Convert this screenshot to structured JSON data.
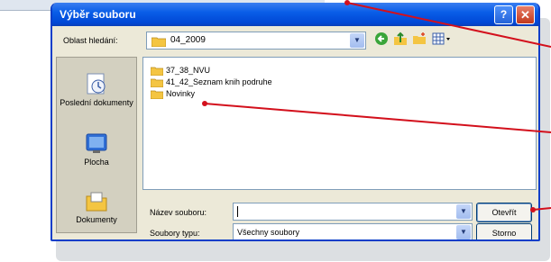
{
  "dialog": {
    "title": "Výběr souboru",
    "help_label": "?",
    "close_label": "✕"
  },
  "lookin": {
    "label": "Oblast hledání:",
    "value": "04_2009"
  },
  "places": [
    {
      "label": "Poslední dokumenty",
      "icon": "recent-documents-icon"
    },
    {
      "label": "Plocha",
      "icon": "desktop-icon"
    },
    {
      "label": "Dokumenty",
      "icon": "documents-icon"
    }
  ],
  "files": [
    {
      "name": "37_38_NVU"
    },
    {
      "name": "41_42_Seznam knih podruhe"
    },
    {
      "name": "Novinky"
    }
  ],
  "filename": {
    "label": "Název souboru:",
    "value": ""
  },
  "filetype": {
    "label": "Soubory typu:",
    "value": "Všechny soubory"
  },
  "buttons": {
    "open": "Otevřít",
    "cancel": "Storno"
  },
  "colors": {
    "titlebar": "#0a5ee8",
    "annotation": "#d3101c",
    "folder": "#f4c542"
  }
}
